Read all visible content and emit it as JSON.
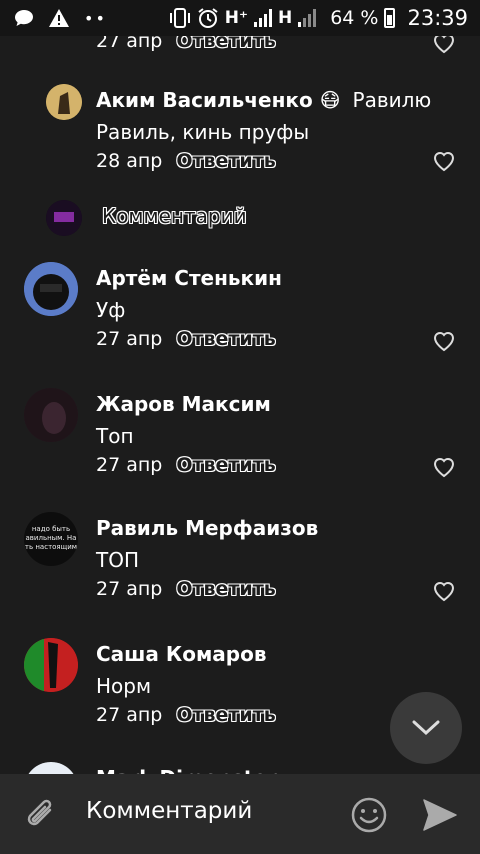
{
  "status_bar": {
    "network1": "H⁺",
    "network2": "H",
    "battery": "64 %",
    "time": "23:39"
  },
  "comments": [
    {
      "name": "",
      "text": "",
      "date": "27 апр",
      "reply": "Ответить",
      "partial": true
    },
    {
      "name": "Аким Васильченко 😷",
      "reply_to": "Равилю",
      "text": "Равиль, кинь пруфы",
      "date": "28 апр",
      "reply": "Ответить",
      "avatar_color": "#c9a95a"
    },
    {
      "name": "Артём Стенькин",
      "text": "Уф",
      "date": "27 апр",
      "reply": "Ответить",
      "avatar_color": "#4a6bb8"
    },
    {
      "name": "Жаров Максим",
      "text": "Топ",
      "date": "27 апр",
      "reply": "Ответить",
      "avatar_color": "#2a1a24"
    },
    {
      "name": "Равиль Мерфаизов",
      "text": "ТОП",
      "date": "27 апр",
      "reply": "Ответить",
      "avatar_color": "#0d0d0d",
      "avatar_text": "надо быть авильным. На ть настоящим"
    },
    {
      "name": "Саша Комаров",
      "text": "Норм",
      "date": "27 апр",
      "reply": "Ответить",
      "avatar_color": "#c21d1d"
    },
    {
      "name": "Mark Dimonstory",
      "partial": true
    }
  ],
  "sub_reply_placeholder": "Комментарий",
  "input": {
    "placeholder": "Комментарий"
  },
  "colors": {
    "background": "#1c1c1c",
    "input_bar": "#2a2a2a",
    "fab": "#3a3a3a"
  },
  "icons": [
    "chat-bubble-icon",
    "alert-icon",
    "vibrate-icon",
    "alarm-icon",
    "heart-icon",
    "attach-icon",
    "emoji-icon",
    "send-icon",
    "chevron-down-icon"
  ]
}
